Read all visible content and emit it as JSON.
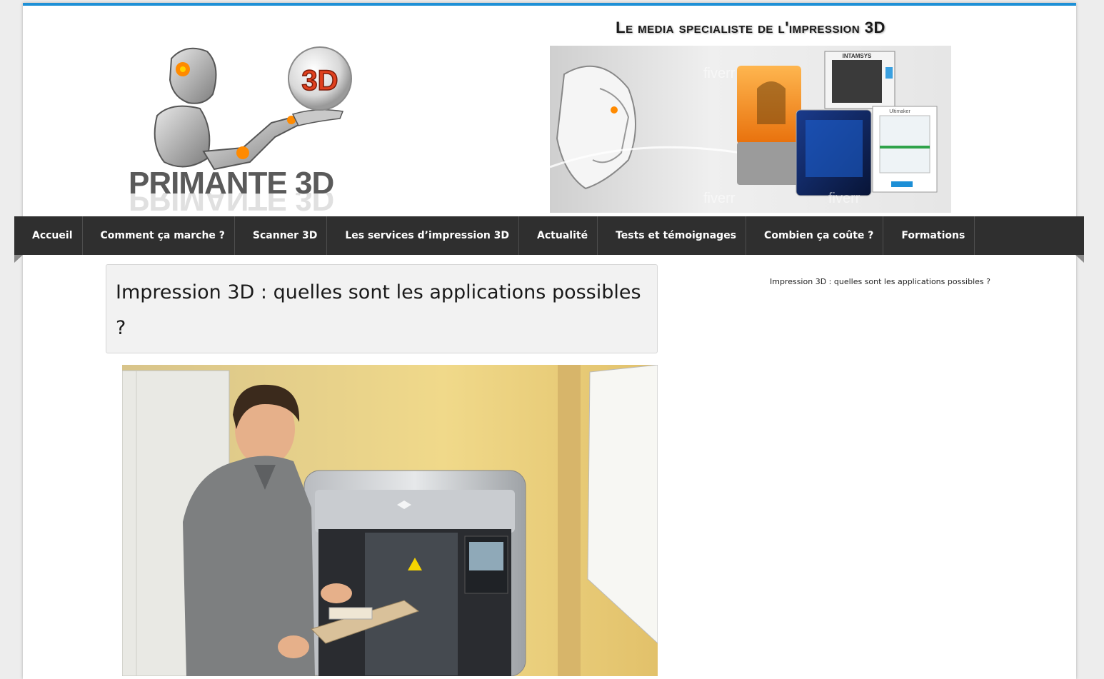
{
  "header": {
    "logo_text": "PRIMANTE 3D",
    "logo_badge": "3D",
    "banner_title": "Le media specialiste de l'impression 3D",
    "banner_brands": [
      "INTAMSYS",
      "Ultimaker"
    ],
    "banner_watermark": "fiverr"
  },
  "nav": {
    "items": [
      {
        "label": "Accueil"
      },
      {
        "label": "Comment ça marche ?"
      },
      {
        "label": "Scanner 3D"
      },
      {
        "label": "Les services d’impression 3D"
      },
      {
        "label": "Actualité"
      },
      {
        "label": "Tests et témoignages"
      },
      {
        "label": "Combien ça coûte ?"
      },
      {
        "label": "Formations"
      }
    ]
  },
  "article": {
    "title": "Impression 3D : quelles sont les applications possibles ?"
  },
  "sidebar": {
    "title_link": "Impression 3D : quelles sont les applications possibles ?"
  },
  "colors": {
    "accent": "#1e90d6",
    "nav_bg": "#2f2f2f",
    "title_box_bg": "#f2f2f2"
  }
}
